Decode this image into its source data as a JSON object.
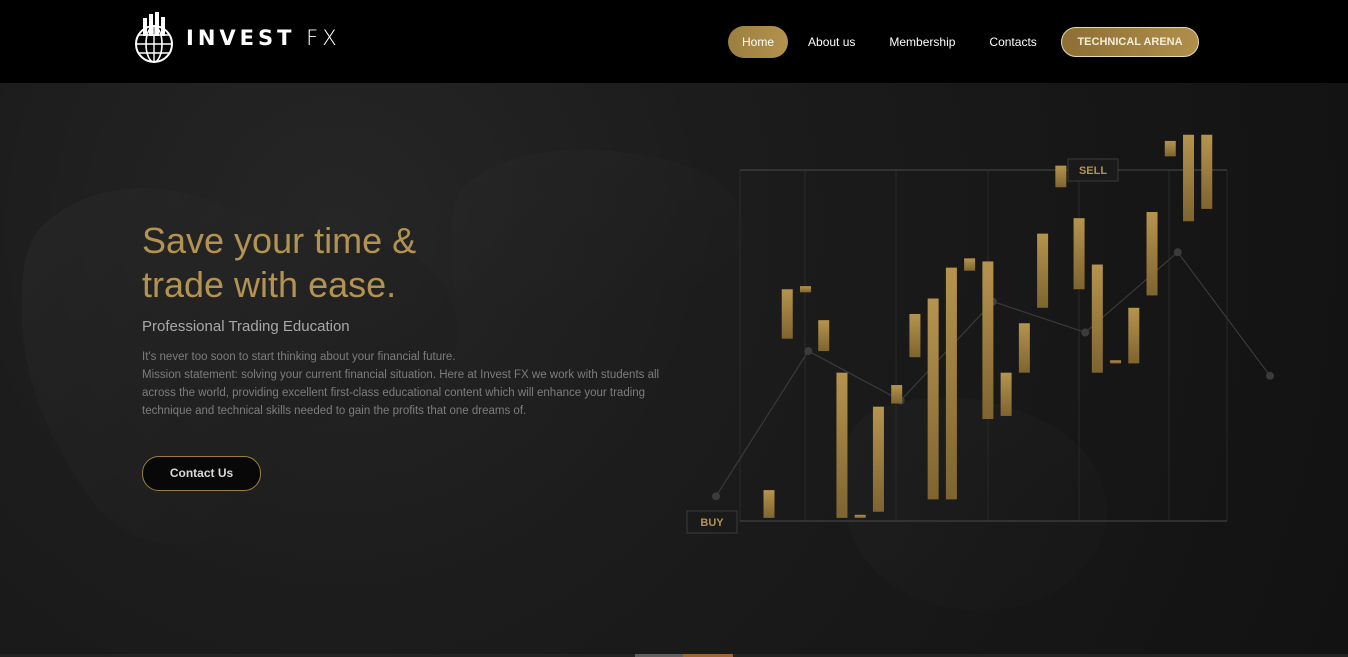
{
  "brand": {
    "name_a": "INVEST",
    "name_b": "FX",
    "logo_icon": "globe-chart-icon"
  },
  "nav": {
    "items": [
      {
        "label": "Home",
        "active": true
      },
      {
        "label": "About us",
        "active": false
      },
      {
        "label": "Membership",
        "active": false
      },
      {
        "label": "Contacts",
        "active": false
      }
    ],
    "cta_label": "TECHNICAL ARENA"
  },
  "hero": {
    "headline_line1": "Save your time &",
    "headline_line2": "trade with ease.",
    "subhead": "Professional Trading Education",
    "paragraph_line1": "It's never too soon to start thinking about your financial future.",
    "paragraph_line2": "Mission statement: solving your current financial situation. Here at Invest FX we work with students all across the world, providing excellent first-class educational content which will enhance your trading technique and technical skills needed to gain the profits that one dreams of.",
    "cta_label": "Contact Us"
  },
  "chart_data": {
    "type": "candlestick",
    "labels": {
      "buy": "BUY",
      "sell": "SELL"
    },
    "candles": [
      [
        1,
        10
      ],
      [
        59,
        75
      ],
      [
        74,
        76
      ],
      [
        55,
        65
      ],
      [
        1,
        48
      ],
      [
        1,
        2
      ],
      [
        3,
        37
      ],
      [
        38,
        44
      ],
      [
        53,
        67
      ],
      [
        7,
        72
      ],
      [
        7,
        82
      ],
      [
        81,
        85
      ],
      [
        33,
        84
      ],
      [
        34,
        48
      ],
      [
        48,
        64
      ],
      [
        69,
        93
      ],
      [
        108,
        115
      ],
      [
        75,
        98
      ],
      [
        48,
        83
      ],
      [
        51,
        52
      ],
      [
        51,
        69
      ],
      [
        73,
        100
      ],
      [
        118,
        123
      ],
      [
        97,
        125
      ],
      [
        101,
        125
      ]
    ],
    "trend_line": [
      8,
      55,
      39,
      71,
      61,
      87,
      47
    ]
  },
  "colors": {
    "accent": "#b39352",
    "background": "#151515",
    "nav_bg": "#000000"
  }
}
